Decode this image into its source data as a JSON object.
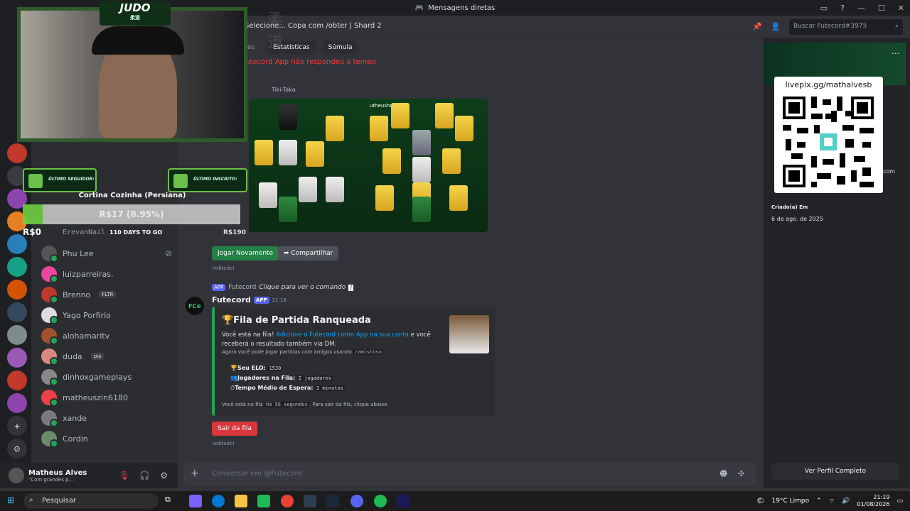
{
  "window": {
    "title": "Mensagens diretas"
  },
  "header": {
    "channel_title": "Selecione... Copa com /obter | Shard 2",
    "search_placeholder": "Buscar Futecord#3975"
  },
  "tabs": [
    {
      "label": "Estatísticas"
    },
    {
      "label": "Súmula"
    }
  ],
  "timeout_text": "Futecord App não respondeu a tempo",
  "embed_image": {
    "caption": "Tiki-Taka",
    "author": "utheushow"
  },
  "price": "R$190",
  "actions": {
    "play_again": "Jogar Novamente",
    "share": "Compartilhar",
    "edited": "(editado)"
  },
  "reply_line": {
    "app": "APP",
    "author": "Futecord",
    "text": "Clique para ver o comando"
  },
  "message": {
    "author": "Futecord",
    "badge": "APP",
    "time": "21:18",
    "embed": {
      "title": "🏆Fila de Partida Ranqueada",
      "line1a": "Você está na fila! ",
      "line1link": "Adicione o Futecord como App na sua conta",
      "line1b": " e você receberá o resultado também via DM.",
      "line2a": "Agora você pode jogar partidas com amigos usando ",
      "line2code": "/amistoso",
      "elo_label": "Seu ELO:",
      "elo_value": "1530",
      "players_label": "Jogadores na Fila:",
      "players_value": "2 jogadores",
      "wait_label": "Tempo Médio de Espera:",
      "wait_value": "2 minutos",
      "footer_a": "Você está na fila ",
      "footer_code": "há 56 segundos",
      "footer_b": ". Para sair da fila, clique abaixo."
    },
    "leave_button": "Sair da fila",
    "edited": "(editado)"
  },
  "composer": {
    "placeholder": "Conversar em @Futecord"
  },
  "dms": [
    {
      "name": "Phu Lee"
    },
    {
      "name": "luizparreiras."
    },
    {
      "name": "Brenno",
      "tag": "FLTR"
    },
    {
      "name": "Yago Porfirio"
    },
    {
      "name": "alohamaritv"
    },
    {
      "name": "duda",
      "tag": "pia"
    },
    {
      "name": "dinhoxgameplays"
    },
    {
      "name": "matheuszin6180"
    },
    {
      "name": "xande"
    },
    {
      "name": "Cordin"
    }
  ],
  "partial_dm": "ErevanNail",
  "user": {
    "name": "Matheus Alves",
    "status": "\"Com grandes p..."
  },
  "profile": {
    "qr_url": "livepix.gg/mathalvesb",
    "created_label": "Criado(a) Em",
    "created_value": "6 de ago. de 2025",
    "view_full": "Ver Perfil Completo",
    "partial_text": "com"
  },
  "overlay": {
    "judo_title": "JUDO",
    "judo_kanji": "柔道",
    "last_follower": "ÚLTIMO SEGUIDOR:",
    "last_subscriber": "ÚLTIMO INSCRITO:",
    "goal_title": "Cortina Cozinha (Persiana)",
    "goal_text": "R$17 (8.95%)",
    "goal_fraction": 0.0895,
    "goal_min": "R$0",
    "goal_days": "110 DAYS TO GO"
  },
  "taskbar": {
    "search": "Pesquisar",
    "weather": "19°C Limpo",
    "time": "21:19",
    "date": "01/08/2026"
  }
}
